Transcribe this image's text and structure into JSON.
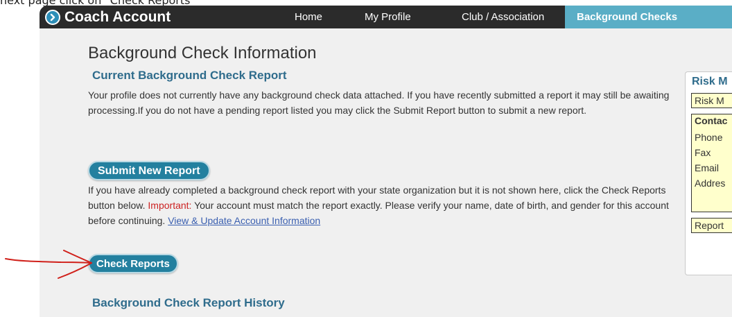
{
  "caption": "next page click on \"Check Reports\"",
  "header": {
    "app_title": "Coach Account",
    "nav": {
      "home": "Home",
      "my_profile": "My Profile",
      "club": "Club / Association",
      "background_checks": "Background Checks"
    }
  },
  "main": {
    "page_title": "Background Check Information",
    "current_section_title": "Current Background Check Report",
    "current_paragraph": "Your profile does not currently have any background check data attached. If you have recently submitted a report it may still be awaiting processing.If you do not have a pending report listed you may click the Submit Report button to submit a new report.",
    "submit_button": "Submit New Report",
    "check_paragraph": "If you have already completed a background check report with your state organization but it is not shown here, click the Check Reports button below.",
    "important_label": "Important:",
    "important_text": "Your account must match the report exactly. Please verify your name, date of birth, and gender for this account before continuing.",
    "account_link": "View & Update Account Information",
    "check_button": "Check Reports",
    "history_section_title": "Background Check Report History"
  },
  "risk_panel": {
    "title": "Risk M",
    "top_box": "Risk M",
    "contact_label": "Contac",
    "phone": "Phone",
    "fax": "Fax",
    "email": "Email",
    "address": "Addres",
    "bottom_box": "Report"
  },
  "colors": {
    "nav_bg": "#2b2b2b",
    "nav_active": "#5aaec6",
    "button": "#23809f",
    "section_title": "#2f6c8c",
    "important": "#cc2222",
    "annotation": "#d0201a",
    "panel_box": "#ffffcc"
  }
}
